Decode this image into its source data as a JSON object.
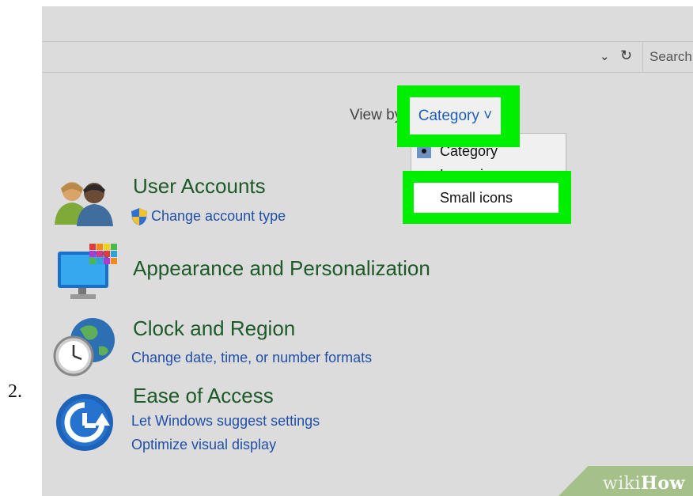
{
  "step_number": "2.",
  "address_bar": {
    "search_placeholder": "Search"
  },
  "view_by": {
    "label": "View by",
    "selected": "Category ˅",
    "options": [
      "Category",
      "Large icons",
      "Small icons"
    ]
  },
  "categories": [
    {
      "title": "User Accounts",
      "links": [
        "Change account type"
      ],
      "icon": "user-accounts-icon"
    },
    {
      "title": "Appearance and Personalization",
      "links": [],
      "icon": "appearance-icon"
    },
    {
      "title": "Clock and Region",
      "links": [
        "Change date, time, or number formats"
      ],
      "icon": "clock-region-icon"
    },
    {
      "title": "Ease of Access",
      "links": [
        "Let Windows suggest settings",
        "Optimize visual display"
      ],
      "icon": "ease-of-access-icon"
    }
  ],
  "watermark": {
    "wiki": "wiki",
    "how": "How"
  },
  "colors": {
    "highlight": "#00ee00",
    "panel_bg": "#dcdcdc",
    "link_blue": "#1f4fa8",
    "title_green": "#1e5a28"
  }
}
